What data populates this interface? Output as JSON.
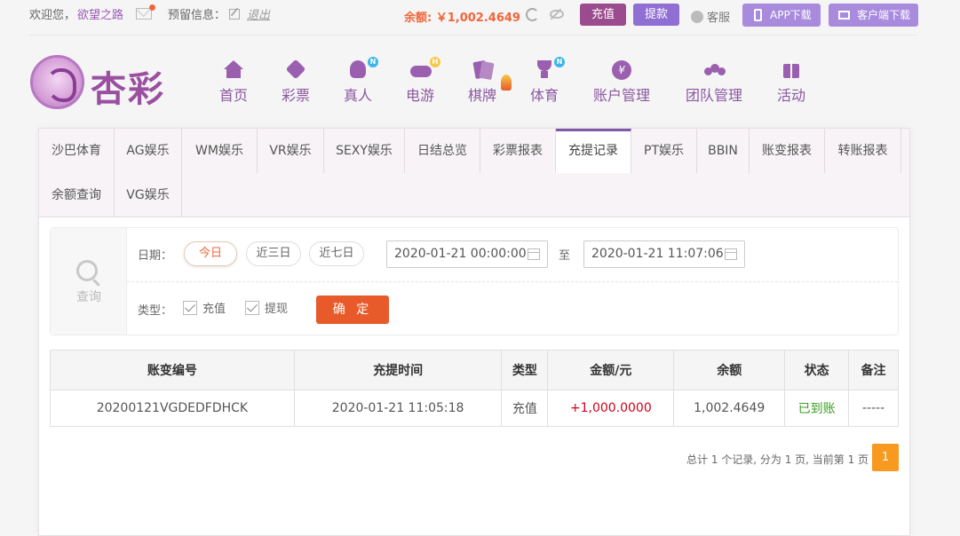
{
  "topbar": {
    "welcome": "欢迎您，",
    "username": "欲望之路",
    "reserve_label": "预留信息：",
    "logout": "退出",
    "balance": "余额: ￥1,002.4649",
    "recharge": "充值",
    "withdraw": "提款",
    "service": "客服",
    "app_download": "APP下载",
    "client_download": "客户端下载"
  },
  "logo": {
    "text": "杏彩"
  },
  "nav": [
    {
      "label": "首页"
    },
    {
      "label": "彩票"
    },
    {
      "label": "真人",
      "badge": "N"
    },
    {
      "label": "电游",
      "badge": "H"
    },
    {
      "label": "棋牌"
    },
    {
      "label": "体育",
      "badge": "N"
    },
    {
      "label": "账户管理",
      "icon_text": "¥"
    },
    {
      "label": "团队管理"
    },
    {
      "label": "活动"
    }
  ],
  "tabs": [
    "沙巴体育",
    "AG娱乐",
    "WM娱乐",
    "VR娱乐",
    "SEXY娱乐",
    "日结总览",
    "彩票报表",
    "充提记录",
    "PT娱乐",
    "BBIN",
    "账变报表",
    "转账报表",
    "余额查询",
    "VG娱乐"
  ],
  "active_tab": "充提记录",
  "search": {
    "title": "查询",
    "date_label": "日期：",
    "quick": [
      "今日",
      "近三日",
      "近七日"
    ],
    "start": "2020-01-21 00:00:00",
    "to": "至",
    "end": "2020-01-21 11:07:06",
    "type_label": "类型：",
    "types": [
      "充值",
      "提现"
    ],
    "confirm": "确 定"
  },
  "table": {
    "headers": [
      "账变编号",
      "充提时间",
      "类型",
      "金额/元",
      "余额",
      "状态",
      "备注"
    ],
    "rows": [
      [
        "20200121VGDEDFDHCK",
        "2020-01-21 11:05:18",
        "充值",
        "+1,000.0000",
        "1,002.4649",
        "已到账",
        "-----"
      ]
    ]
  },
  "pager": {
    "summary": "总计 1 个记录, 分为 1 页, 当前第 1 页",
    "current": "1"
  },
  "colors": {
    "accent": "#9b4c8e",
    "orange": "#e85a2a",
    "purple": "#8f6fd4"
  }
}
